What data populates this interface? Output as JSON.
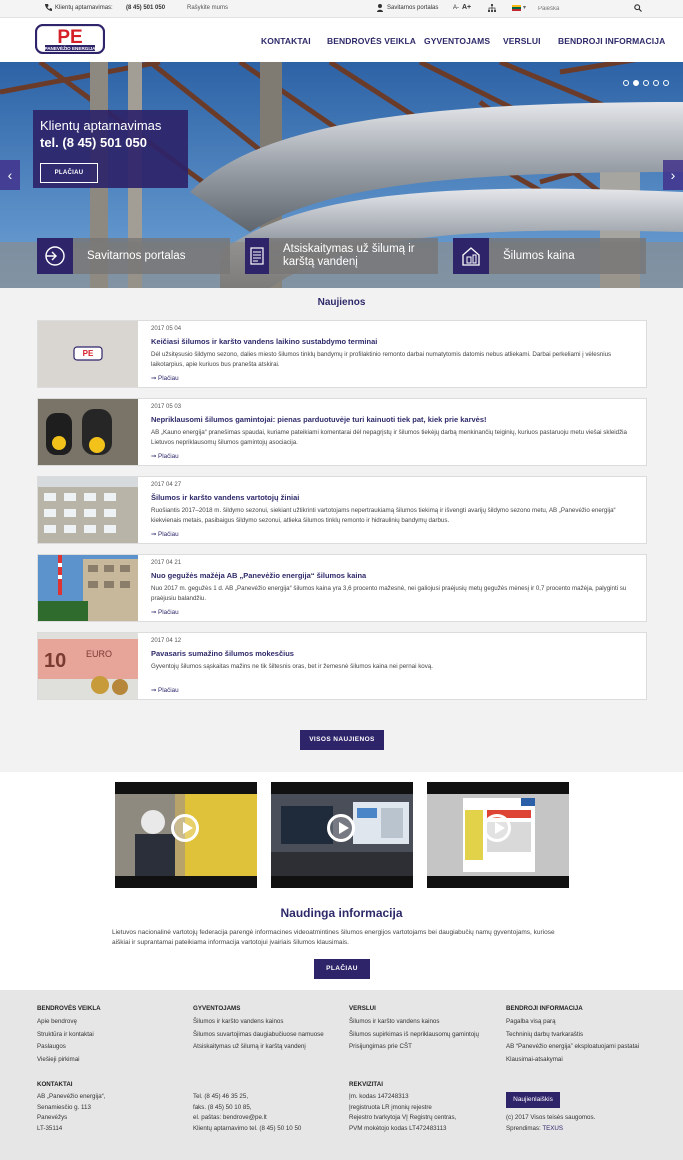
{
  "topbar": {
    "phone_label": "Klientų aptarnavimas:",
    "phone_number": "(8 45) 501 050",
    "write_us": "Rašykite mums",
    "self_service": "Savitarnos portalas",
    "font_small": "A-",
    "font_large": "A+",
    "search_placeholder": "Paieška"
  },
  "nav": {
    "items": [
      "KONTAKTAI",
      "BENDROVĖS VEIKLA",
      "GYVENTOJAMS",
      "VERSLUI",
      "BENDROJI INFORMACIJA"
    ]
  },
  "hero": {
    "line1": "Klientų aptarnavimas",
    "line2": "tel. (8 45) 501 050",
    "button": "PLAČIAU",
    "active_slide": 2,
    "slide_count": 5,
    "tiles": [
      "Savitarnos portalas",
      "Atsiskaitymas už šilumą ir karštą vandenį",
      "Šilumos kaina"
    ]
  },
  "news": {
    "heading": "Naujienos",
    "more_label": "Plačiau",
    "all_button": "VISOS NAUJIENOS",
    "items": [
      {
        "date": "2017 05 04",
        "title": "Keičiasi šilumos ir karšto vandens laikino sustabdymo terminai",
        "excerpt": "Dėl užsitęsusio šildymo sezono, dalies miesto šilumos tinklų bandymų ir profilaktinio remonto darbai numatytomis datomis nebus atliekami. Darbai perkeliami į vėlesnius laikotarpius, apie kuriuos bus pranešta atskirai."
      },
      {
        "date": "2017 05 03",
        "title": "Nepriklausomi šilumos gamintojai: pienas parduotuvėje turi kainuoti tiek pat, kiek prie karvės!",
        "excerpt": "AB „Kauno energija“ pranešimas spaudai, kuriame pateikiami komentarai dėl nepagrįstų ir šilumos tiekėjų darbą menkinančių teiginių, kuriuos pastaruoju metu viešai skleidžia Lietuvos nepriklausomų šilumos gamintojų asociacija."
      },
      {
        "date": "2017 04 27",
        "title": "Šilumos ir karšto vandens vartotojų žiniai",
        "excerpt": "Ruošiantis 2017–2018 m. šildymo sezonui, siekiant užtikrinti vartotojams nepertraukiamą šilumos tiekimą ir išvengti avarijų šildymo sezono metu, AB „Panevėžio energija“ kiekvienais metais, pasibaigus šildymo sezonui, atlieka šilumos tinklų remonto ir hidraulinių bandymų darbus."
      },
      {
        "date": "2017 04 21",
        "title": "Nuo gegužės mažėja AB „Panevėžio energija“ šilumos kaina",
        "excerpt": "Nuo 2017 m. gegužės 1 d. AB „Panevėžio energija“ šilumos kaina yra 3,6 procento mažesnė, nei galiojusi praėjusių metų gegužės mėnesį ir 0,7 procento mažėja, palyginti su praėjusiu balandžiu."
      },
      {
        "date": "2017 04 12",
        "title": "Pavasaris sumažino šilumos mokesčius",
        "excerpt": "Gyventojų šilumos sąskaitas mažins ne tik šiltesnis oras, bet ir žemesnė šilumos kaina nei pernai kovą."
      }
    ]
  },
  "useful": {
    "heading": "Naudinga informacija",
    "text": "Lietuvos nacionalinė vartotojų federacija parengė informacines videoatmintines šilumos energijos vartotojams bei daugiabučių namų gyventojams, kuriose aiškiai ir suprantamai pateikiama informacija vartotojui įvairiais šilumos klausimais.",
    "button": "PLAČIAU"
  },
  "footer": {
    "cols": [
      {
        "heading": "BENDROVĖS VEIKLA",
        "links": [
          "Apie bendrovę",
          "Struktūra ir kontaktai",
          "Paslaugos",
          "Viešieji pirkimai"
        ]
      },
      {
        "heading": "GYVENTOJAMS",
        "links": [
          "Šilumos ir karšto vandens kainos",
          "Šilumos suvartojimas daugiabučiuose namuose",
          "Atsiskaitymas už šilumą ir karštą vandenį"
        ]
      },
      {
        "heading": "VERSLUI",
        "links": [
          "Šilumos ir karšto vandens kainos",
          "Šilumos supirkimas iš nepriklausomų gamintojų",
          "Prisijungimas prie CŠT"
        ]
      },
      {
        "heading": "BENDROJI INFORMACIJA",
        "links": [
          "Pagalba visą parą",
          "Techninių darbų tvarkaraštis",
          "AB “Panevėžio energija” eksploatuojami pastatai",
          "Klausimai-atsakymai"
        ]
      }
    ],
    "contacts_heading": "KONTAKTAI",
    "address": [
      "AB „Panevėžio energija“,",
      "Senamiesčio g. 113",
      "Panevėžys",
      "LT-35114"
    ],
    "phones": [
      "Tel. (8 45) 46 35 25,",
      "faks. (8 45) 50 10 85,",
      "el. paštas: bendrove@pe.lt",
      "Klientų aptarnavimo tel. (8 45) 50 10 50"
    ],
    "details_heading": "REKVIZITAI",
    "details": [
      "Įm. kodas 147248313",
      "Įregistruota LR įmonių rejestre",
      "Rejestro tvarkytoja VĮ Registrų centras,",
      "PVM mokėtojo kodas LT472483113"
    ],
    "newsletter": "Naujienlaiškis",
    "copyright": "(c) 2017 Visos teisės saugomos.",
    "made_by_label": "Sprendimas:",
    "made_by": "TEXUS"
  },
  "colors": {
    "brand": "#2e246a",
    "accent_red": "#d62027"
  }
}
